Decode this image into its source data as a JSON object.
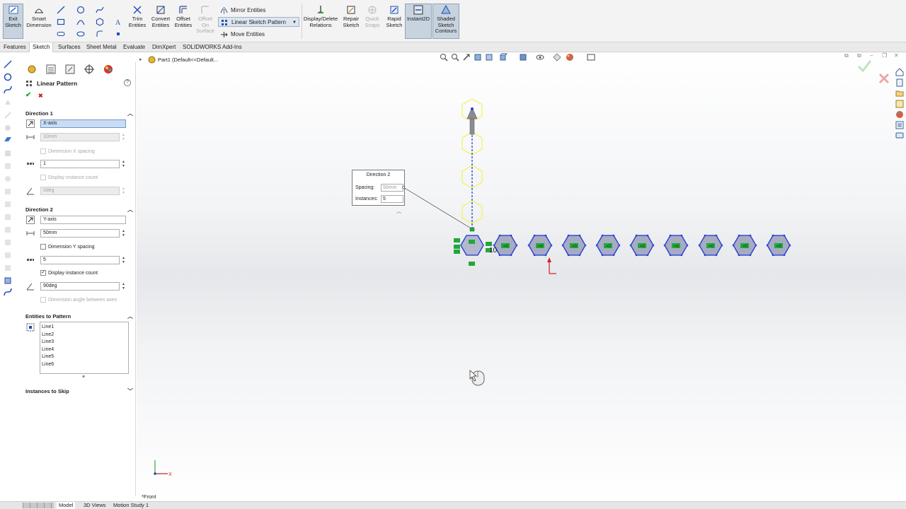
{
  "ribbon": {
    "exit_sketch": "Exit Sketch",
    "smart_dimension": "Smart Dimension",
    "trim_entities": "Trim Entities",
    "convert_entities": "Convert Entities",
    "offset_entities": "Offset Entities",
    "offset_on_surface": "Offset On Surface",
    "mirror_entities": "Mirror Entities",
    "linear_sketch_pattern": "Linear Sketch Pattern",
    "move_entities": "Move Entities",
    "display_delete_relations": "Display/Delete Relations",
    "repair_sketch": "Repair Sketch",
    "quick_snaps": "Quick Snaps",
    "rapid_sketch": "Rapid Sketch",
    "instant2d": "Instant2D",
    "shaded_sketch_contours": "Shaded Sketch Contours"
  },
  "tabs": [
    "Features",
    "Sketch",
    "Surfaces",
    "Sheet Metal",
    "Evaluate",
    "DimXpert",
    "SOLIDWORKS Add-Ins"
  ],
  "tree": {
    "part_label": "Part1  (Default<<Default..."
  },
  "pm": {
    "title": "Linear Pattern",
    "help": "?",
    "ok": "✔",
    "cancel": "✖",
    "direction1": {
      "header": "Direction 1",
      "axis": "X-axis",
      "spacing": "10mm",
      "dim_spacing_label": "Dimension X spacing",
      "instances": "1",
      "display_count_label": "Display instance count",
      "angle": "0deg"
    },
    "direction2": {
      "header": "Direction 2",
      "axis": "Y-axis",
      "spacing": "50mm",
      "dim_spacing_label": "Dimension Y spacing",
      "instances": "5",
      "display_count_label": "Display instance count",
      "angle": "90deg",
      "dim_angle_label": "Dimension angle between axes"
    },
    "entities": {
      "header": "Entities to Pattern",
      "items": [
        "Line1",
        "Line2",
        "Line3",
        "Line4",
        "Line5",
        "Line6"
      ]
    },
    "skip": {
      "header": "Instances to Skip"
    }
  },
  "callout": {
    "title": "Direction 2",
    "spacing_label": "Spacing:",
    "spacing_value": "50mm",
    "instances_label": "Instances:",
    "instances_value": "5"
  },
  "canvas": {
    "instance_tag": "10",
    "relation_tag": "=0",
    "view_label": "*Front",
    "triad_x": "X"
  },
  "bottom_tabs": [
    "Model",
    "3D Views",
    "Motion Study 1"
  ],
  "colors": {
    "accent": "#1f4fb7",
    "selected_blue": "#2a3fd1",
    "preview_yellow": "#f2f25a",
    "relation_green": "#22a83a",
    "origin_red": "#d22020"
  }
}
